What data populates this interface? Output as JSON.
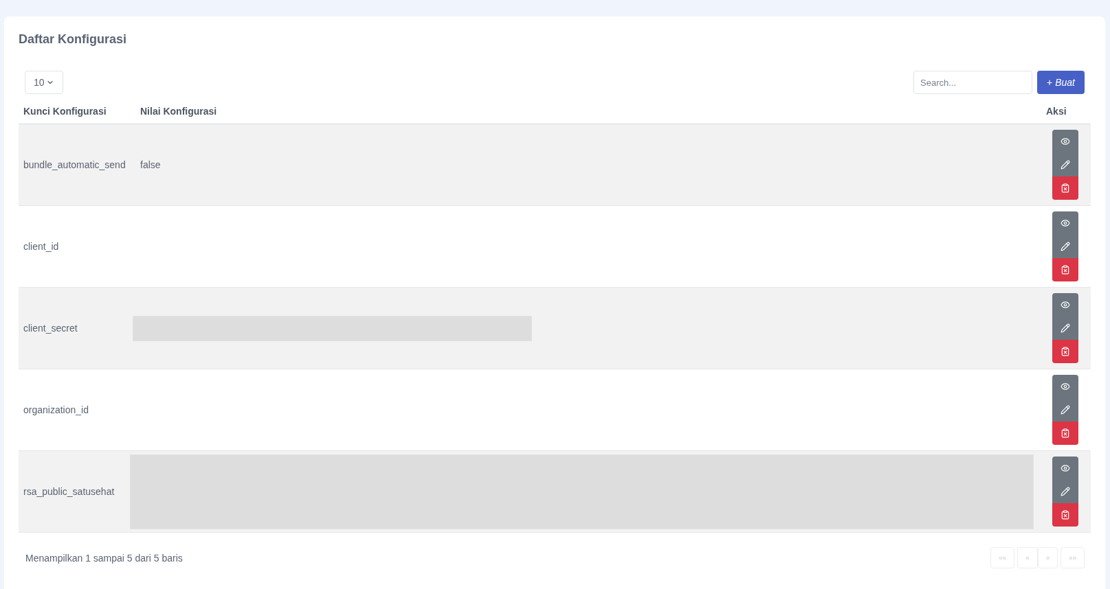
{
  "card": {
    "title": "Daftar Konfigurasi"
  },
  "toolbar": {
    "page_size": "10",
    "search": {
      "placeholder": "Search..."
    },
    "create_button": {
      "label": "+ *Buat*"
    }
  },
  "table": {
    "columns": [
      "Kunci Konfigurasi",
      "Nilai Konfigurasi",
      "Aksi"
    ],
    "rows": [
      {
        "key": "bundle_automatic_send",
        "kind": "text",
        "value": "false"
      },
      {
        "key": "client_id",
        "kind": "empty"
      },
      {
        "key": "client_secret",
        "kind": "redacted-bar"
      },
      {
        "key": "organization_id",
        "kind": "empty"
      },
      {
        "key": "rsa_public_satusehat",
        "kind": "redacted-block"
      }
    ]
  },
  "footer": {
    "summary": "Menampilkan 1 sampai 5 dari 5 baris",
    "pagination": [
      {
        "label": "««",
        "disabled": true
      },
      {
        "label": "«",
        "disabled": true
      },
      {
        "label": "»",
        "disabled": true
      },
      {
        "label": "»»",
        "disabled": true
      }
    ]
  }
}
